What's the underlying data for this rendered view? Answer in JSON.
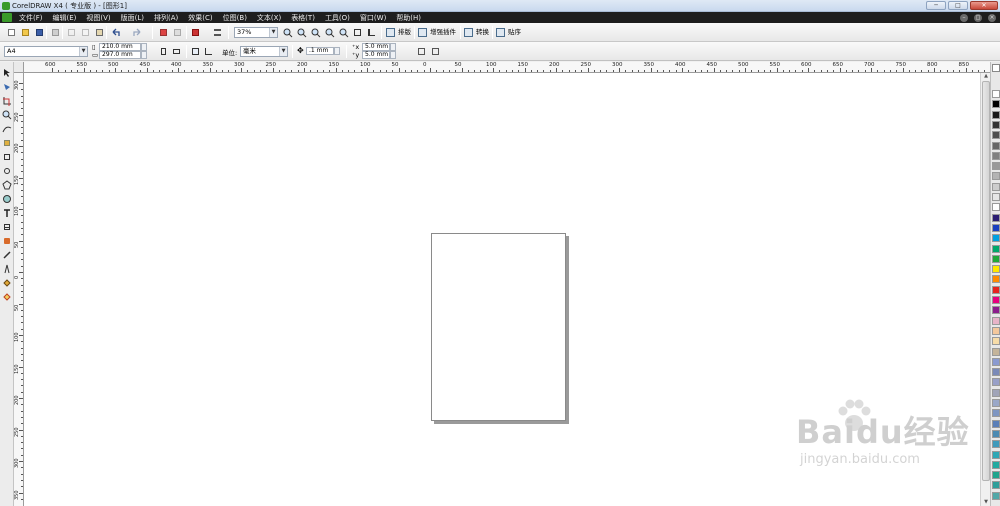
{
  "window": {
    "title": "CorelDRAW X4 ( 专业版 ) - [图形1]",
    "min_label": "─",
    "max_label": "□",
    "close_label": "✕"
  },
  "menu": {
    "items": [
      "文件(F)",
      "编辑(E)",
      "视图(V)",
      "版面(L)",
      "排列(A)",
      "效果(C)",
      "位图(B)",
      "文本(X)",
      "表格(T)",
      "工具(O)",
      "窗口(W)",
      "帮助(H)"
    ],
    "mdi_controls": [
      "–",
      "◻",
      "×"
    ]
  },
  "toolbar": {
    "zoom_value": "37%",
    "buttons": {
      "layout": "排版",
      "plugin": "增强插件",
      "convert": "转换",
      "paste": "贴序"
    }
  },
  "property_bar": {
    "paper_size": "A4",
    "width": "210.0 mm",
    "height": "297.0 mm",
    "units_label": "单位:",
    "units_value": "毫米",
    "nudge": ".1 mm",
    "dup_x": "5.0 mm",
    "dup_y": "5.0 mm"
  },
  "ruler": {
    "h_labels": [
      "600",
      "550",
      "500",
      "450",
      "400",
      "350",
      "300",
      "250",
      "200",
      "150",
      "100",
      "50",
      "0",
      "50",
      "100",
      "150",
      "200",
      "250",
      "300",
      "350",
      "400",
      "450",
      "500",
      "550",
      "600",
      "650",
      "700",
      "750",
      "800",
      "850"
    ],
    "v_labels": [
      "300",
      "250",
      "200",
      "150",
      "100",
      "50",
      "0",
      "50",
      "100",
      "150",
      "200",
      "250",
      "300",
      "350"
    ]
  },
  "palette": {
    "colors": [
      "#ffffff",
      "#000000",
      "#1a1a1a",
      "#333333",
      "#4d4d4d",
      "#666666",
      "#808080",
      "#999999",
      "#b3b3b3",
      "#cccccc",
      "#e6e6e6",
      "#ffffff",
      "#2b1d72",
      "#1a3fbf",
      "#00a0e0",
      "#00a86b",
      "#1fa83a",
      "#ffe600",
      "#ff8c00",
      "#e6231f",
      "#e6007e",
      "#8c1c8c",
      "#e8b4c8",
      "#f4c89c",
      "#f7dca8",
      "#c4b49a",
      "#8a9ad0",
      "#7a8ab8",
      "#98a0c8",
      "#a0a4b8",
      "#9aa8c8",
      "#7e96c2",
      "#5a7fb8",
      "#4a8ab2",
      "#3f9abb",
      "#2fa8b5",
      "#21aaa0",
      "#1fa58d",
      "#2f9f9a",
      "#50a8a8",
      "#6fb3b3",
      "#8fc2c2"
    ]
  },
  "watermark": {
    "brand": "Baidu经验",
    "sub": "jingyan.baidu.com"
  }
}
